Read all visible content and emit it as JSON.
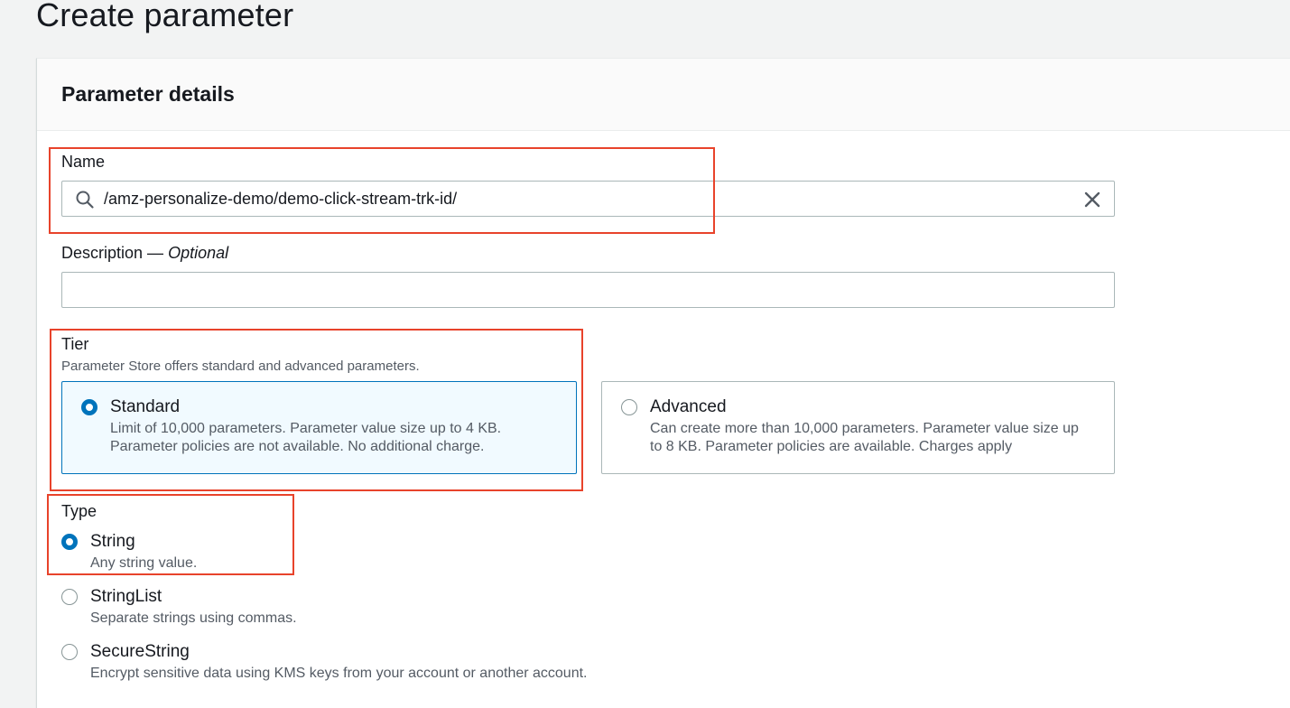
{
  "page": {
    "title": "Create parameter"
  },
  "panel": {
    "title": "Parameter details"
  },
  "name_field": {
    "label": "Name",
    "value": "/amz-personalize-demo/demo-click-stream-trk-id/"
  },
  "description_field": {
    "label": "Description —",
    "label_optional": "Optional",
    "value": ""
  },
  "tier": {
    "label": "Tier",
    "hint": "Parameter Store offers standard and advanced parameters.",
    "options": [
      {
        "title": "Standard",
        "desc_line1": "Limit of 10,000 parameters. Parameter value size up to 4 KB.",
        "desc_line2": "Parameter policies are not available. No additional charge.",
        "selected": true
      },
      {
        "title": "Advanced",
        "desc_line1": "Can create more than 10,000 parameters. Parameter value size up",
        "desc_line2": "to 8 KB. Parameter policies are available. Charges apply",
        "selected": false
      }
    ]
  },
  "type": {
    "label": "Type",
    "options": [
      {
        "title": "String",
        "desc": "Any string value.",
        "selected": true
      },
      {
        "title": "StringList",
        "desc": "Separate strings using commas.",
        "selected": false
      },
      {
        "title": "SecureString",
        "desc": "Encrypt sensitive data using KMS keys from your account or another account.",
        "selected": false
      }
    ]
  },
  "colors": {
    "accent": "#0073bb",
    "annotation": "#e8432b",
    "selected_tile_bg": "#f1faff"
  },
  "icons": {
    "search": "search-icon",
    "clear": "close-icon"
  }
}
